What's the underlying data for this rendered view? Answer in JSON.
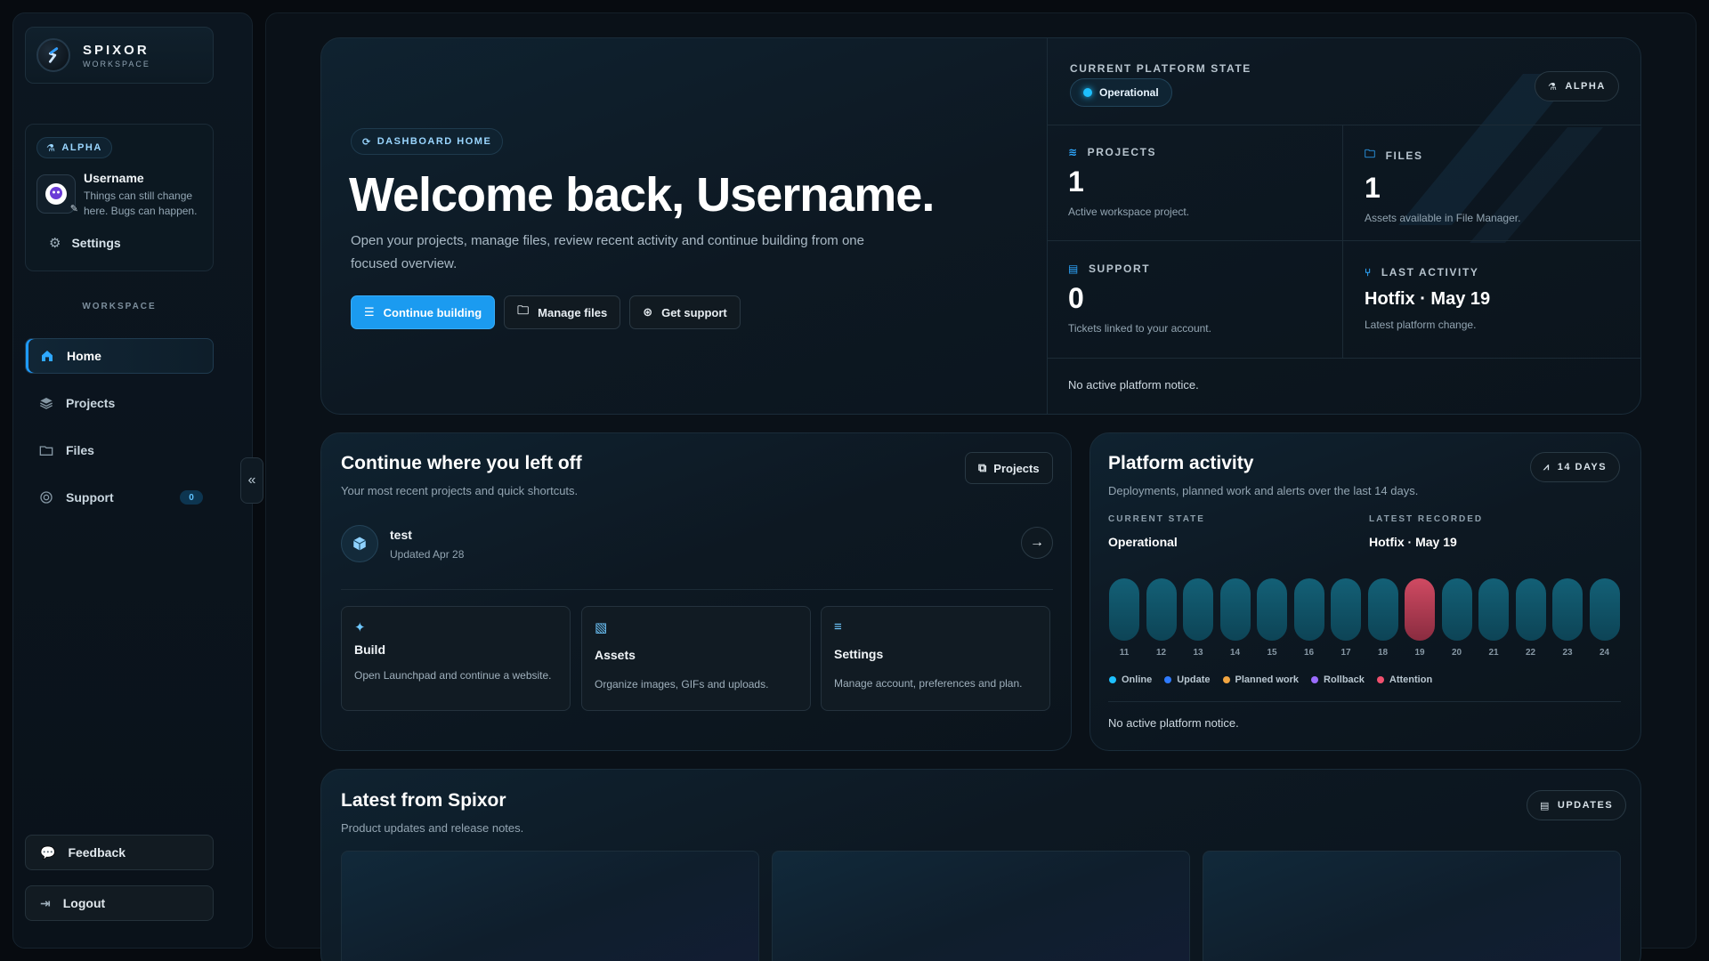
{
  "brand": {
    "name": "SPIXOR",
    "sub": "WORKSPACE"
  },
  "user": {
    "badge": "ALPHA",
    "name": "Username",
    "note": "Things can still change here. Bugs can happen.",
    "settings_label": "Settings"
  },
  "sidebar": {
    "section": "WORKSPACE",
    "items": [
      {
        "label": "Home",
        "icon": "home-icon"
      },
      {
        "label": "Projects",
        "icon": "layers-icon"
      },
      {
        "label": "Files",
        "icon": "folder-icon"
      },
      {
        "label": "Support",
        "icon": "lifebuoy-icon",
        "badge": "0"
      }
    ],
    "feedback_label": "Feedback",
    "logout_label": "Logout",
    "collapse_glyph": "«"
  },
  "hero": {
    "tag": "DASHBOARD HOME",
    "title": "Welcome back, Username.",
    "description": "Open your projects, manage files, review recent activity and continue building from one focused overview.",
    "buttons": {
      "continue": "Continue building",
      "files": "Manage files",
      "support": "Get support"
    }
  },
  "platform": {
    "label": "CURRENT PLATFORM STATE",
    "state": "Operational",
    "badge": "ALPHA",
    "stats": {
      "projects": {
        "label": "PROJECTS",
        "value": "1",
        "sub": "Active workspace project."
      },
      "files": {
        "label": "FILES",
        "value": "1",
        "sub": "Assets available in File Manager."
      },
      "support": {
        "label": "SUPPORT",
        "value": "0",
        "sub": "Tickets linked to your account."
      },
      "activity": {
        "label": "LAST ACTIVITY",
        "value": "Hotfix · May 19",
        "sub": "Latest platform change."
      }
    },
    "notice": "No active platform notice."
  },
  "recent": {
    "title": "Continue where you left off",
    "subtitle": "Your most recent projects and quick shortcuts.",
    "projects_button": "Projects",
    "project": {
      "name": "test",
      "updated": "Updated Apr 28"
    },
    "shortcuts": [
      {
        "title": "Build",
        "desc": "Open Launchpad and continue a website.",
        "icon": "magic-wand-icon"
      },
      {
        "title": "Assets",
        "desc": "Organize images, GIFs and uploads.",
        "icon": "image-icon"
      },
      {
        "title": "Settings",
        "desc": "Manage account, preferences and plan.",
        "icon": "sliders-icon"
      }
    ]
  },
  "activity": {
    "title": "Platform activity",
    "subtitle": "Deployments, planned work and alerts over the last 14 days.",
    "range_button": "14 DAYS",
    "current_label": "CURRENT STATE",
    "current_value": "Operational",
    "latest_label": "LATEST RECORDED",
    "latest_value": "Hotfix · May 19",
    "days": [
      "11",
      "12",
      "13",
      "14",
      "15",
      "16",
      "17",
      "18",
      "19",
      "20",
      "21",
      "22",
      "23",
      "24"
    ],
    "day_status": [
      "online",
      "online",
      "online",
      "online",
      "online",
      "online",
      "online",
      "online",
      "attention",
      "online",
      "online",
      "online",
      "online",
      "online"
    ],
    "legend": [
      {
        "label": "Online",
        "color": "#1ec0ff"
      },
      {
        "label": "Update",
        "color": "#2f7bff"
      },
      {
        "label": "Planned work",
        "color": "#f2a541"
      },
      {
        "label": "Rollback",
        "color": "#9b6cff"
      },
      {
        "label": "Attention",
        "color": "#f0506e"
      }
    ],
    "notice": "No active platform notice."
  },
  "latest": {
    "title": "Latest from Spixor",
    "subtitle": "Product updates and release notes.",
    "button": "UPDATES"
  },
  "colors": {
    "accent": "#1b9bf0",
    "attention": "#d04a62"
  }
}
